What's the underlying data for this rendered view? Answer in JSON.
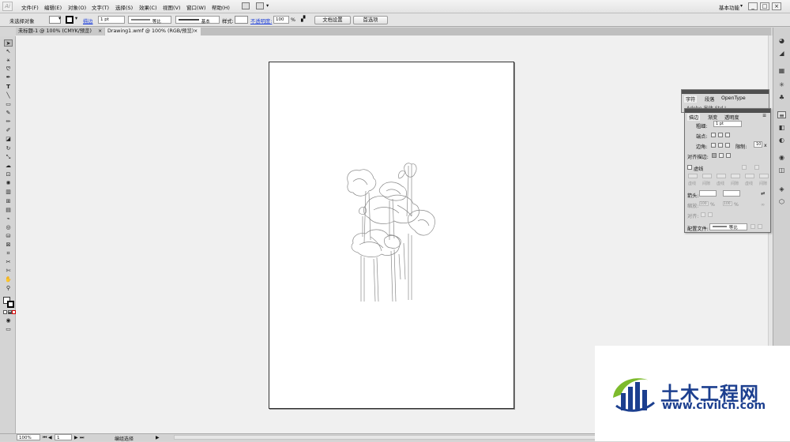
{
  "menubar": {
    "logo": "Ai",
    "items": [
      "文件(F)",
      "编辑(E)",
      "对象(O)",
      "文字(T)",
      "选择(S)",
      "效果(C)",
      "视图(V)",
      "窗口(W)",
      "帮助(H)"
    ],
    "workspace": "基本功能",
    "window_controls": [
      "_",
      "□",
      "×"
    ]
  },
  "control_bar": {
    "selection_label": "未选择对象",
    "stroke_label": "描边",
    "stroke_weight": "1 pt",
    "profile": "等比",
    "brush": "基本",
    "style_label": "样式:",
    "opacity_label": "不透明度:",
    "opacity_value": "100",
    "percent": "%",
    "doc_setup_button": "文档设置",
    "prefs_button": "首选项"
  },
  "tabs": [
    {
      "label": "未标题-1 @ 100% (CMYK/预览)",
      "close": "×"
    },
    {
      "label": "Drawing1.wmf @ 100% (RGB/预览)",
      "close": "×"
    }
  ],
  "tools": [
    "selection-tool",
    "direct-selection-tool",
    "magic-wand-tool",
    "lasso-tool",
    "pen-tool",
    "type-tool",
    "line-tool",
    "rectangle-tool",
    "paintbrush-tool",
    "pencil-tool",
    "blob-brush-tool",
    "eraser-tool",
    "rotate-tool",
    "scale-tool",
    "warp-tool",
    "free-transform-tool",
    "symbol-sprayer-tool",
    "column-graph-tool",
    "mesh-tool",
    "gradient-tool",
    "eyedropper-tool",
    "blend-tool",
    "live-paint-tool",
    "live-paint-selection-tool",
    "crop-area-tool",
    "slice-tool",
    "scissors-tool",
    "hand-tool",
    "zoom-tool"
  ],
  "character_panel": {
    "tabs": [
      "字符",
      "段落",
      "OpenType"
    ],
    "font_field": "Adobe 宋体 Std L"
  },
  "stroke_panel": {
    "tabs": [
      "描边",
      "渐变",
      "透明度"
    ],
    "weight_label": "粗细:",
    "weight_value": "1 pt",
    "cap_label": "端点:",
    "corner_label": "边角:",
    "limit_label": "限制:",
    "limit_value": "10",
    "limit_unit": "x",
    "align_label": "对齐描边:",
    "dashed_label": "虚线",
    "dash_fields": [
      "虚线",
      "间隙",
      "虚线",
      "间隙",
      "虚线",
      "间隙"
    ],
    "arrow_label": "箭头:",
    "scale_label": "缩放:",
    "scale_values": [
      "100",
      "100"
    ],
    "scale_unit": "%",
    "align_arrow_label": "对齐:",
    "profile_label": "配置文件:",
    "profile_value": "等比"
  },
  "statusbar": {
    "zoom": "100%",
    "artboard": "1",
    "status": "编组选择"
  },
  "watermark": {
    "title": "土木工程网",
    "url": "www.civilcn.com"
  },
  "colors": {
    "accent": "#1d3fd9",
    "watermark_blue": "#1c3f8f",
    "watermark_green": "#7dbb2c"
  }
}
